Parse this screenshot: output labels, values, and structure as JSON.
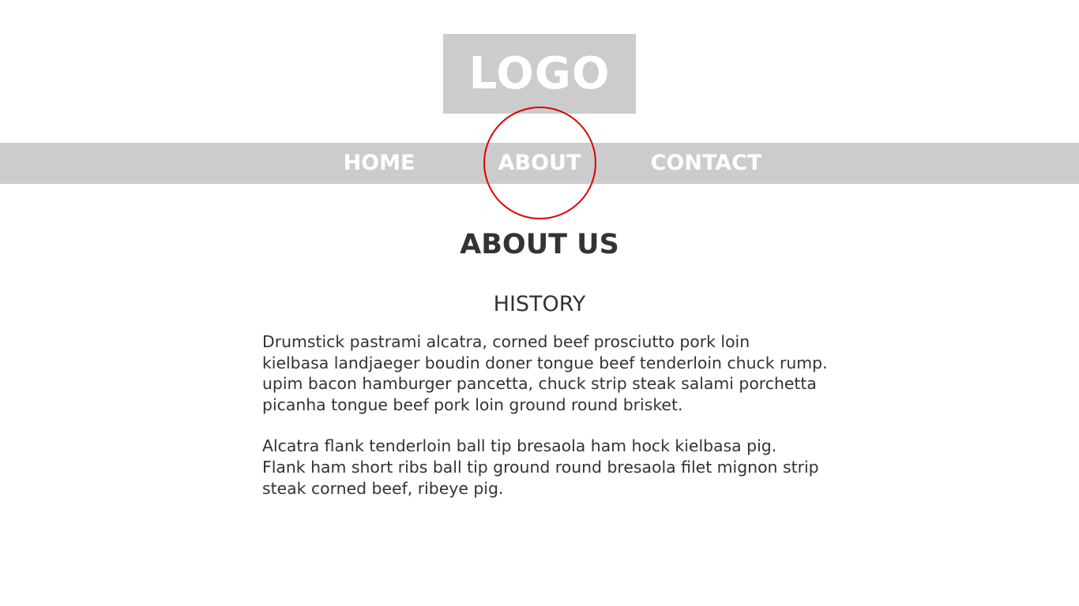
{
  "header": {
    "logo_text": "LOGO"
  },
  "nav": {
    "items": [
      {
        "label": "HOME"
      },
      {
        "label": "ABOUT"
      },
      {
        "label": "CONTACT"
      }
    ],
    "active": "ABOUT",
    "highlight_color": "#e00000",
    "bar_color": "#cccccc"
  },
  "main": {
    "title": "ABOUT US",
    "section_title": "HISTORY",
    "paragraphs": [
      "Drumstick pastrami alcatra, corned beef prosciutto pork loin\nkielbasa landjaeger boudin doner tongue beef tenderloin chuck rump.\nupim bacon hamburger pancetta, chuck strip steak salami porchetta\npicanha tongue beef pork loin ground round brisket.",
      "Alcatra flank tenderloin ball tip bresaola ham hock kielbasa pig.\nFlank ham short ribs ball tip ground round bresaola filet mignon strip\nsteak corned beef, ribeye pig."
    ]
  }
}
